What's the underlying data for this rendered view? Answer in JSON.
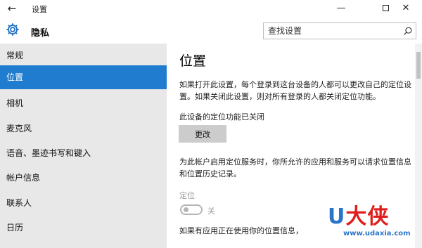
{
  "window": {
    "title": "设置",
    "back_icon": "back-arrow-icon",
    "minimize_symbol": "—",
    "close_symbol": "✕"
  },
  "header": {
    "title": "隐私",
    "icon": "gear-icon",
    "search_placeholder": "查找设置"
  },
  "sidebar": {
    "items": [
      {
        "label": "常规",
        "active": false
      },
      {
        "label": "位置",
        "active": true
      },
      {
        "label": "相机",
        "active": false
      },
      {
        "label": "麦克风",
        "active": false
      },
      {
        "label": "语音、墨迹书写和键入",
        "active": false
      },
      {
        "label": "帐户信息",
        "active": false
      },
      {
        "label": "联系人",
        "active": false
      },
      {
        "label": "日历",
        "active": false
      }
    ]
  },
  "main": {
    "heading": "位置",
    "description": "如果打开此设置，每个登录到这台设备的人都可以更改自己的定位设置。如果关闭此设置，则对所有登录的人都关闭定位功能。",
    "device_status": "此设备的定位功能已关闭",
    "change_button": "更改",
    "service_description": "为此帐户启用定位服务时，你所允许的应用和服务可以请求位置信息和位置历史记录。",
    "location_label": "定位",
    "toggle_state_label": "关",
    "toggle_on": false,
    "apps_note": "如果有应用正在使用你的位置信息，"
  },
  "watermark": {
    "letter": "U",
    "chars": "大侠",
    "site": "www.udaxia.com"
  },
  "colors": {
    "accent": "#1f7ccf",
    "sidebar_bg": "#e8e8e8",
    "button_bg": "#cccccc"
  }
}
